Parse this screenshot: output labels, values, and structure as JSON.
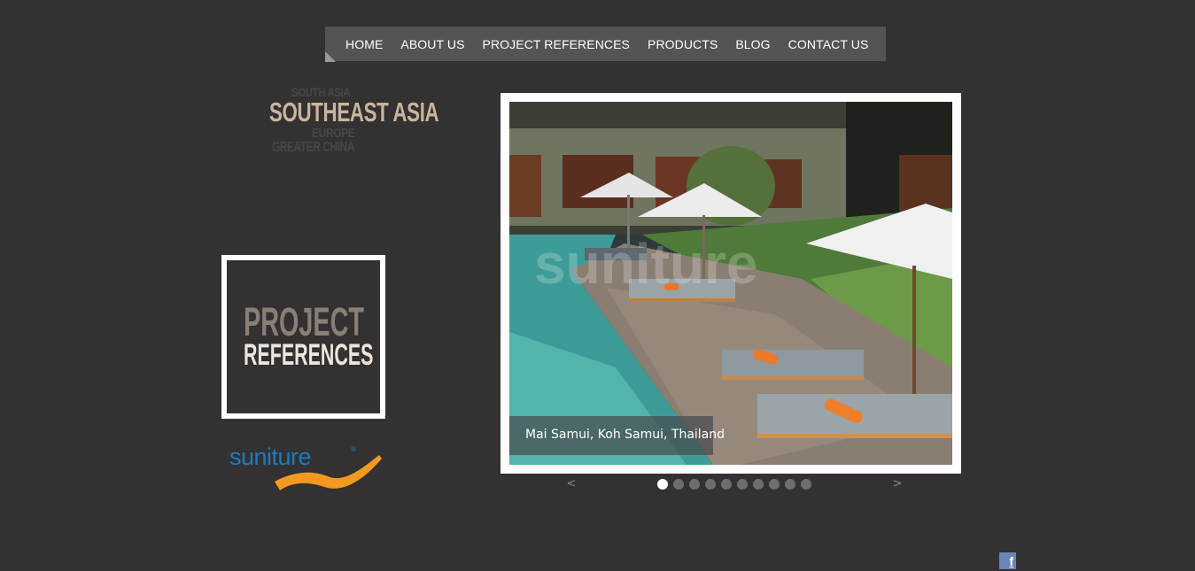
{
  "nav": {
    "items": [
      "HOME",
      "ABOUT US",
      "PROJECT REFERENCES",
      "PRODUCTS",
      "BLOG",
      "CONTACT US"
    ]
  },
  "regions": {
    "south_asia": "SOUTH ASIA",
    "southeast_asia": "SOUTHEAST ASIA",
    "europe": "EUROPE",
    "greater_china": "GREATER CHINA"
  },
  "project_box": {
    "line1": "PROJECT",
    "line2": "REFERENCES"
  },
  "logo": {
    "text": "suniture",
    "reg": "®"
  },
  "slider": {
    "caption": "Mai Samui, Koh Samui, Thailand",
    "watermark": "suniture",
    "prev": "<",
    "next": ">",
    "dot_count": 10,
    "active_index": 0
  },
  "social": {
    "facebook": "f"
  },
  "colors": {
    "background": "#333132",
    "nav": "#555455",
    "accent_gold": "#c8b59c",
    "logo_blue": "#1d7bbf",
    "logo_orange": "#f39a1e"
  }
}
